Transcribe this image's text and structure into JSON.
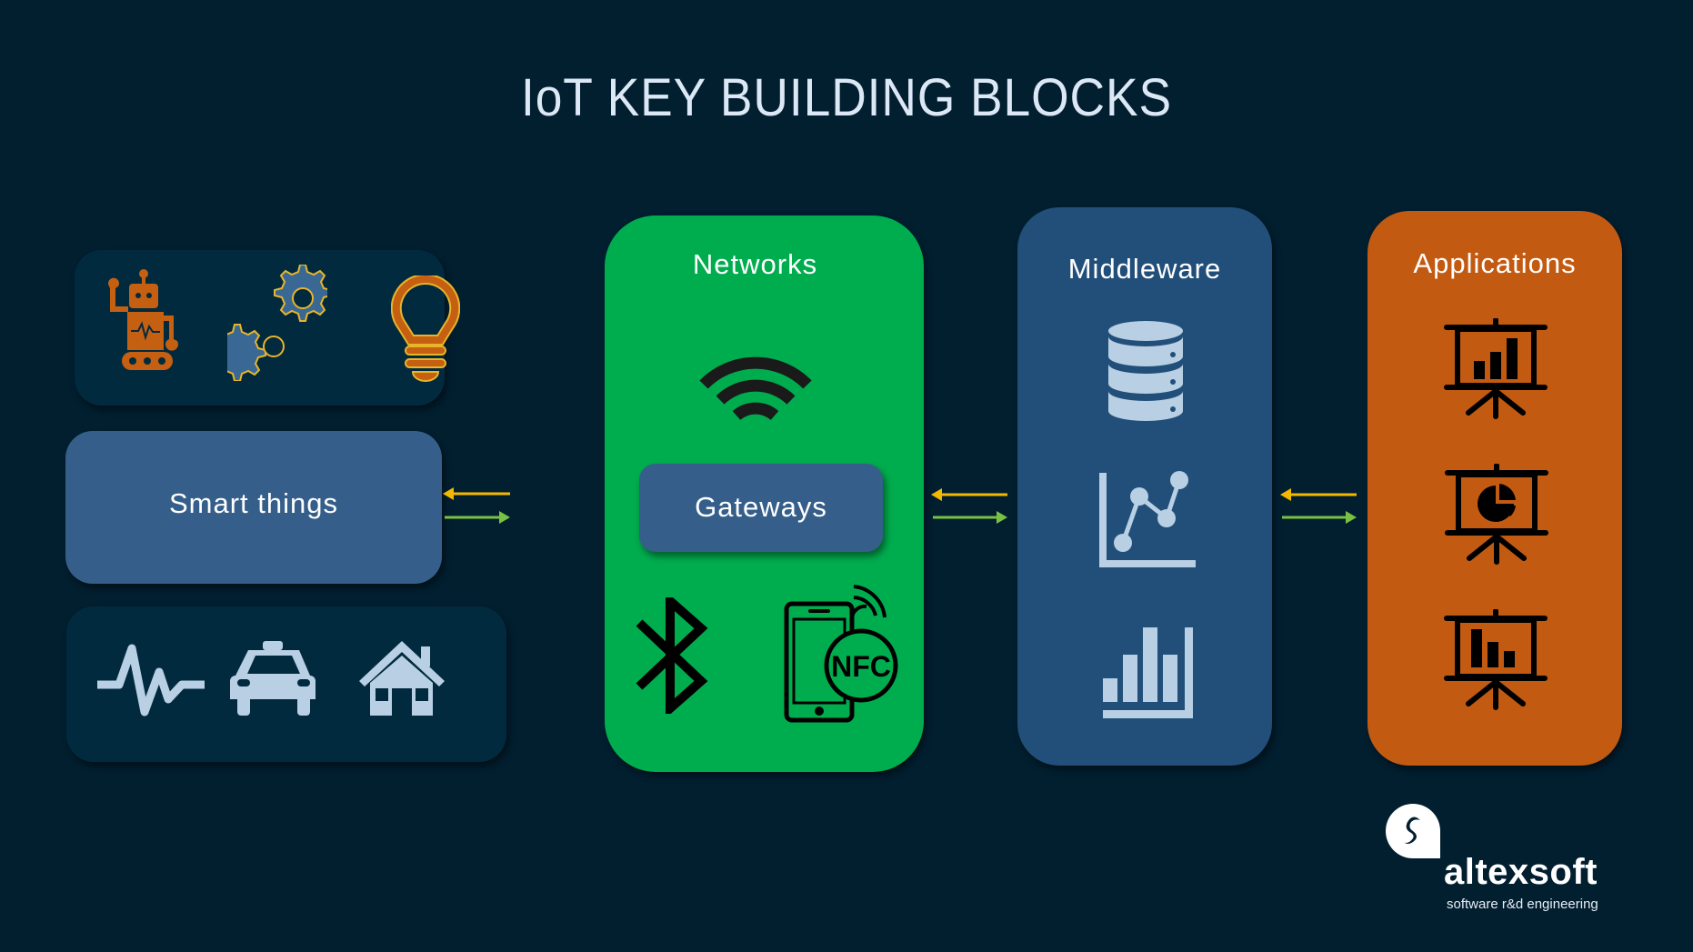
{
  "title": "IoT KEY BUILDING BLOCKS",
  "colors": {
    "background": "#021f30",
    "device_box": "#022a3e",
    "smart_things_box": "#355f8a",
    "networks_panel": "#00ad4e",
    "middleware_panel": "#214f79",
    "applications_panel": "#c35a12",
    "arrow_left": "#f5b800",
    "arrow_right": "#7ac143",
    "icon_light": "#b8cfe4",
    "icon_orange": "#c55f12",
    "icon_gold": "#e8b52a"
  },
  "smart_things": {
    "label": "Smart things",
    "top_icons": [
      "robot-icon",
      "gears-icon",
      "lightbulb-icon"
    ],
    "bottom_icons": [
      "heartbeat-icon",
      "taxi-icon",
      "house-icon"
    ]
  },
  "networks": {
    "label": "Networks",
    "gateways_label": "Gateways",
    "icons": [
      "wifi-icon",
      "bluetooth-icon",
      "nfc-phone-icon"
    ],
    "nfc_text": "NFC"
  },
  "middleware": {
    "label": "Middleware",
    "icons": [
      "database-icon",
      "line-chart-icon",
      "bar-chart-icon"
    ]
  },
  "applications": {
    "label": "Applications",
    "icons": [
      "presentation-bar-chart-icon",
      "presentation-pie-chart-icon",
      "presentation-column-chart-icon"
    ]
  },
  "arrows": [
    {
      "between": [
        "Smart things",
        "Networks"
      ],
      "directions": [
        "left",
        "right"
      ]
    },
    {
      "between": [
        "Networks",
        "Middleware"
      ],
      "directions": [
        "left",
        "right"
      ]
    },
    {
      "between": [
        "Middleware",
        "Applications"
      ],
      "directions": [
        "left",
        "right"
      ]
    }
  ],
  "logo": {
    "name": "altexsoft",
    "tagline": "software r&d engineering"
  }
}
